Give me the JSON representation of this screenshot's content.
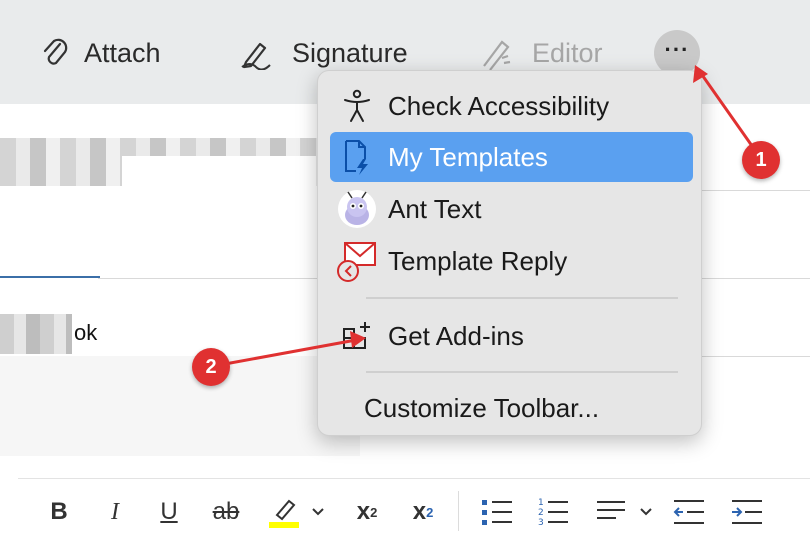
{
  "toolbar": {
    "attach_label": "Attach",
    "signature_label": "Signature",
    "editor_label": "Editor",
    "more_label": "···"
  },
  "compose": {
    "partial_text": "ok"
  },
  "menu": {
    "items": [
      {
        "label": "Check Accessibility",
        "icon": "accessibility-icon"
      },
      {
        "label": "My Templates",
        "icon": "templates-icon",
        "selected": true
      },
      {
        "label": "Ant Text",
        "icon": "ant-icon"
      },
      {
        "label": "Template Reply",
        "icon": "template-reply-icon"
      },
      {
        "label": "Get Add-ins",
        "icon": "add-ins-icon"
      },
      {
        "label": "Customize Toolbar..."
      }
    ]
  },
  "annotations": {
    "badge1": "1",
    "badge2": "2",
    "color": "#e03131"
  },
  "format": {
    "bold": "B",
    "italic": "I",
    "underline": "U",
    "strike": "ab",
    "superscript": "x",
    "superscript_mark": "2",
    "subscript": "x",
    "subscript_mark": "2",
    "highlight_color": "#ffff00"
  },
  "colors": {
    "toolbar_bg": "#e9ebec",
    "menu_bg": "#e6e6e6",
    "selected_bg": "#5aa0f0",
    "accent_blue": "#3b6fa8"
  }
}
